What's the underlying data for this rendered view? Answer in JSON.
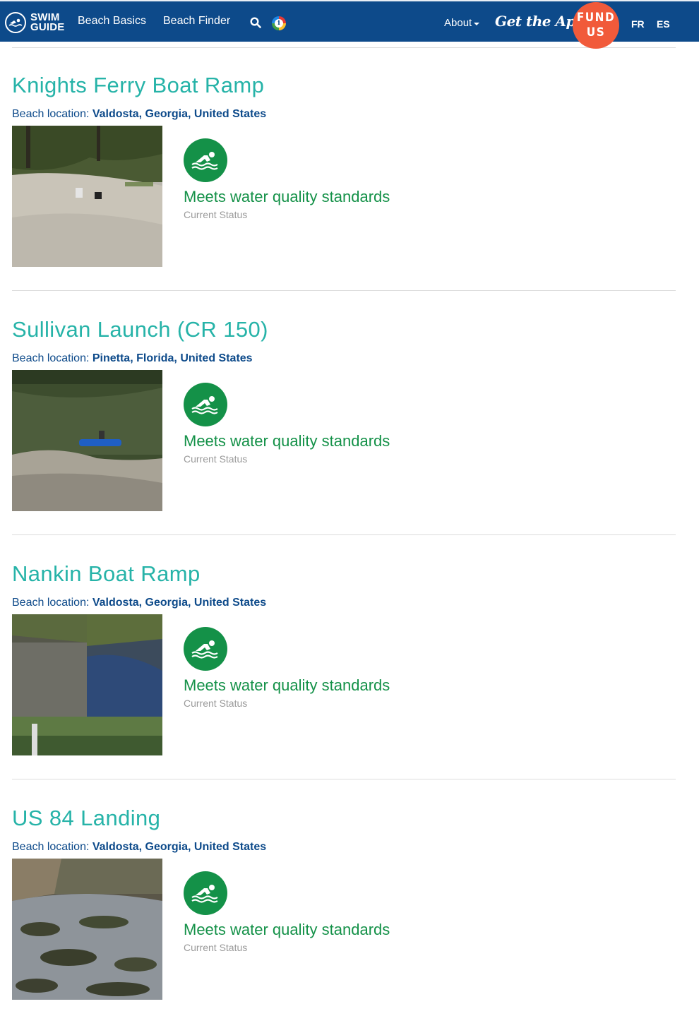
{
  "nav": {
    "logo_line1": "SWIM",
    "logo_line2": "GUIDE",
    "beach_basics": "Beach Basics",
    "beach_finder": "Beach Finder",
    "about": "About",
    "get_app": "Get the App",
    "fund_line1": "FUND",
    "fund_line2": "US",
    "lang_fr": "FR",
    "lang_es": "ES"
  },
  "colors": {
    "navbar": "#0d4a8a",
    "title_teal": "#26b3a8",
    "status_green": "#149148",
    "fund_orange": "#f15a3a"
  },
  "beaches": [
    {
      "title": "Knights Ferry Boat Ramp",
      "location_label": "Beach location: ",
      "location": "Valdosta, Georgia, United States",
      "status": "Meets water quality standards",
      "status_sub": "Current Status",
      "status_icon": "swimmer-icon"
    },
    {
      "title": "Sullivan Launch (CR 150)",
      "location_label": "Beach location: ",
      "location": "Pinetta, Florida, United States",
      "status": "Meets water quality standards",
      "status_sub": "Current Status",
      "status_icon": "swimmer-icon"
    },
    {
      "title": "Nankin Boat Ramp",
      "location_label": "Beach location: ",
      "location": "Valdosta, Georgia, United States",
      "status": "Meets water quality standards",
      "status_sub": "Current Status",
      "status_icon": "swimmer-icon"
    },
    {
      "title": "US 84 Landing",
      "location_label": "Beach location: ",
      "location": "Valdosta, Georgia, United States",
      "status": "Meets water quality standards",
      "status_sub": "Current Status",
      "status_icon": "swimmer-icon"
    }
  ]
}
